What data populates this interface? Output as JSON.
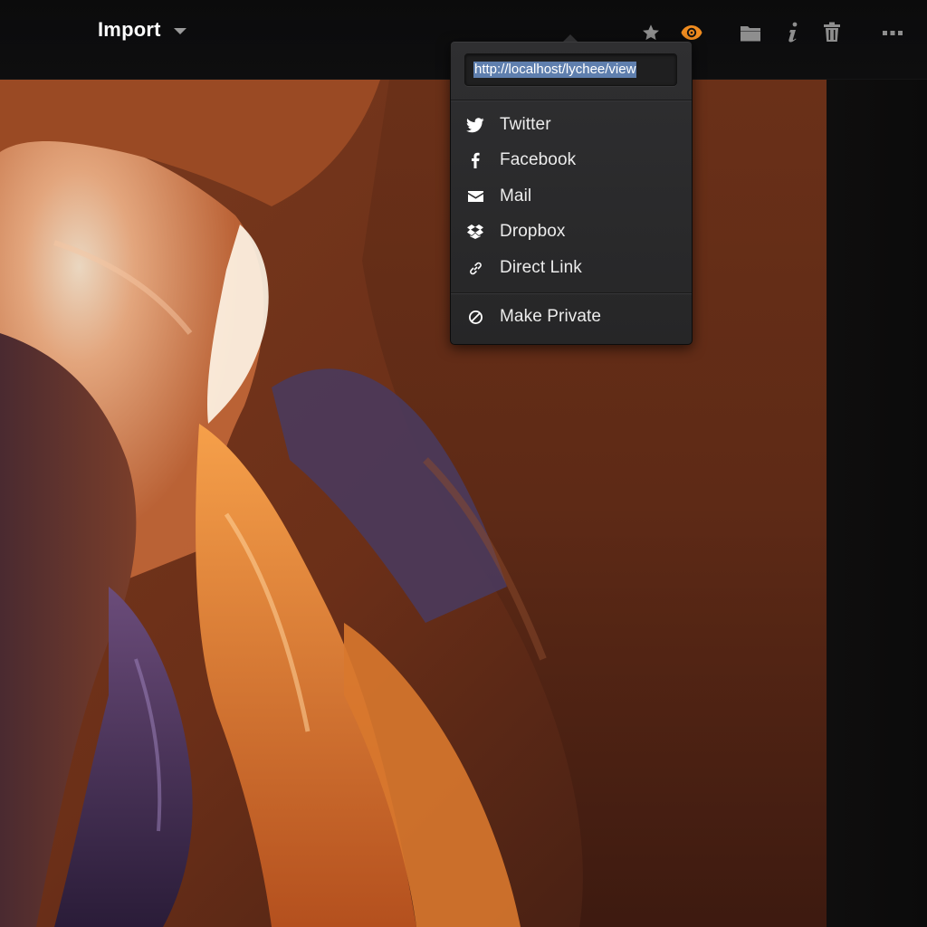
{
  "header": {
    "title": "Import",
    "buttons": [
      {
        "name": "star",
        "icon": "star-icon",
        "color": "#8e8e8e"
      },
      {
        "name": "eye",
        "icon": "eye-icon",
        "color": "#ef8b1f"
      },
      {
        "name": "folder",
        "icon": "folder-icon",
        "color": "#8e8e8e"
      },
      {
        "name": "info",
        "icon": "info-icon",
        "color": "#8e8e8e"
      },
      {
        "name": "trash",
        "icon": "trash-icon",
        "color": "#8e8e8e"
      },
      {
        "name": "more",
        "icon": "more-icon",
        "color": "#8e8e8e"
      }
    ]
  },
  "share_menu": {
    "url": "http://localhost/lychee/view",
    "items": [
      {
        "label": "Twitter",
        "icon": "twitter-icon"
      },
      {
        "label": "Facebook",
        "icon": "facebook-icon"
      },
      {
        "label": "Mail",
        "icon": "mail-icon"
      },
      {
        "label": "Dropbox",
        "icon": "dropbox-icon"
      },
      {
        "label": "Direct Link",
        "icon": "link-icon"
      }
    ],
    "private_item": {
      "label": "Make Private",
      "icon": "private-icon"
    }
  },
  "photo": {
    "subject": "photo-canyon"
  },
  "colors": {
    "accent": "#ef8b1f",
    "header_bg": "#0d0d0e",
    "menu_bg": "#2b2b2d",
    "selection": "#5f7fae"
  }
}
